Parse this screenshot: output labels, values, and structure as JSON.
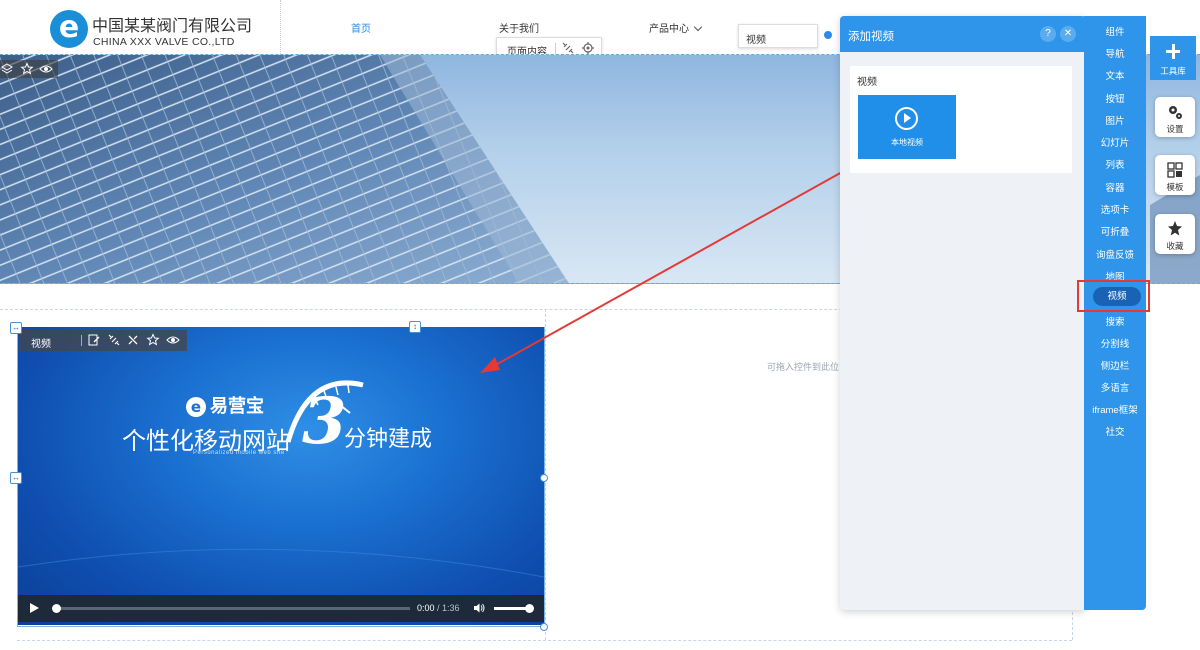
{
  "header": {
    "logo_glyph": "e",
    "company_cn": "中国某某阀门有限公司",
    "company_en": "CHINA XXX VALVE CO.,LTD",
    "nav": [
      {
        "label": "首页",
        "active": true
      },
      {
        "label": "关于我们",
        "active": false
      },
      {
        "label": "产品中心",
        "active": false
      }
    ]
  },
  "page_content_bar": {
    "label": "页面内容"
  },
  "selected_chip": {
    "label": "视频"
  },
  "canvas": {
    "drop_hint": "可拖入控件到此位",
    "video_toolbar_label": "视频"
  },
  "video": {
    "brand_glyph": "e",
    "brand_name": "易营宝",
    "slogan_part1": "个性化移动网站",
    "slogan_number": "3",
    "slogan_part2": "分钟建成",
    "slogan_en": "Personalized mobile web site",
    "current_time": "0:00",
    "duration": "/ 1:36",
    "progress": 0.0,
    "volume": 1.0
  },
  "panel": {
    "title": "添加视频",
    "help": "?",
    "close": "✕",
    "section_title": "视频",
    "item_label": "本地视频"
  },
  "sidebar": {
    "items": [
      "组件",
      "导航",
      "文本",
      "按钮",
      "图片",
      "幻灯片",
      "列表",
      "容器",
      "选项卡",
      "可折叠",
      "询盘反馈",
      "地图",
      "视频",
      "搜索",
      "分割线",
      "侧边栏",
      "多语言",
      "iframe框架",
      "社交"
    ],
    "active_index": 12
  },
  "right_tabs": {
    "toolbox": "工具库",
    "settings": "设置",
    "template": "模板",
    "favorites": "收藏"
  },
  "colors": {
    "accent": "#2e95ea",
    "active_item": "#1a63b4",
    "highlight": "#e53935"
  }
}
